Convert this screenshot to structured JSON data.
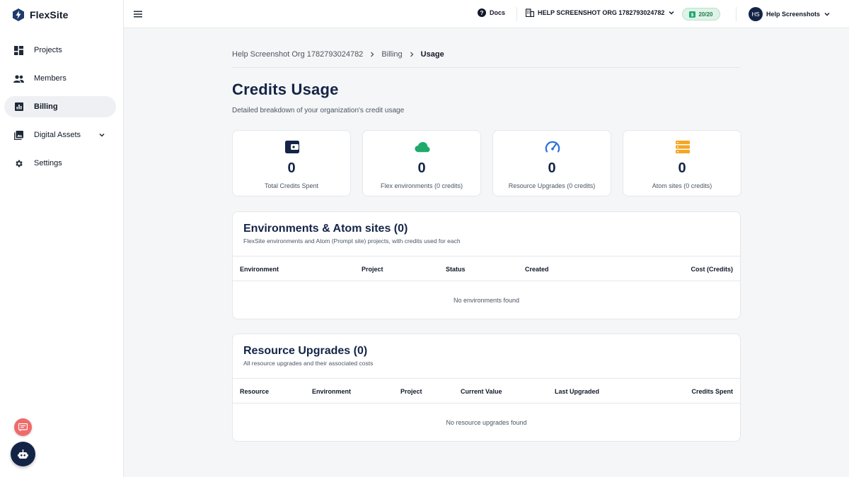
{
  "app": {
    "name": "FlexSite"
  },
  "sidebar": {
    "items": [
      {
        "label": "Projects",
        "icon": "dashboard-icon",
        "active": false
      },
      {
        "label": "Members",
        "icon": "people-icon",
        "active": false
      },
      {
        "label": "Billing",
        "icon": "bar-chart-icon",
        "active": true
      },
      {
        "label": "Digital Assets",
        "icon": "image-gallery-icon",
        "active": false,
        "expandable": true
      },
      {
        "label": "Settings",
        "icon": "gear-icon",
        "active": false
      }
    ]
  },
  "topbar": {
    "docs_label": "Docs",
    "org_label": "HELP SCREENSHOT ORG 1782793024782",
    "credits": "20/20",
    "user_initials": "HS",
    "user_name": "Help Screenshots"
  },
  "breadcrumb": {
    "items": [
      "Help Screenshot Org 1782793024782",
      "Billing",
      "Usage"
    ]
  },
  "page": {
    "title": "Credits Usage",
    "subtitle": "Detailed breakdown of your organization's credit usage"
  },
  "stats": [
    {
      "value": "0",
      "label": "Total Credits Spent",
      "icon": "wallet-icon",
      "color": "#142447"
    },
    {
      "value": "0",
      "label": "Flex environments (0 credits)",
      "icon": "cloud-icon",
      "color": "#1faa6b"
    },
    {
      "value": "0",
      "label": "Resource Upgrades (0 credits)",
      "icon": "speedometer-icon",
      "color": "#2f6fde"
    },
    {
      "value": "0",
      "label": "Atom sites (0 credits)",
      "icon": "storage-icon",
      "color": "#f5a623"
    }
  ],
  "environments": {
    "title": "Environments & Atom sites (0)",
    "subtitle": "FlexSite environments and Atom (Prompt site) projects, with credits used for each",
    "columns": [
      "Environment",
      "Project",
      "Status",
      "Created",
      "Cost (Credits)"
    ],
    "empty": "No environments found"
  },
  "upgrades": {
    "title": "Resource Upgrades (0)",
    "subtitle": "All resource upgrades and their associated costs",
    "columns": [
      "Resource",
      "Environment",
      "Project",
      "Current Value",
      "Last Upgraded",
      "Credits Spent"
    ],
    "empty": "No resource upgrades found"
  },
  "colors": {
    "navy": "#142447",
    "support_button": "#ef6b6b",
    "credits_pill_bg": "#dff3e8"
  }
}
